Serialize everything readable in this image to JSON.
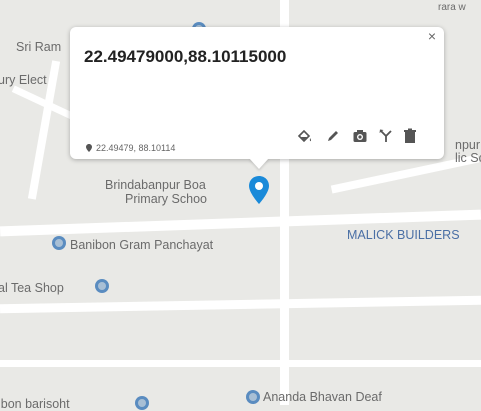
{
  "map": {
    "labels": {
      "sri_ram": "Sri Ram",
      "ury_elect": "ury Elect",
      "top_right": "rara w",
      "right_edge_1": "npur",
      "right_edge_2": "lic Sc",
      "school_1": "Brindabanpur Boa",
      "school_2": "Primary Schoo",
      "panchayat": "Banibon Gram Panchayat",
      "malick": "MALICK BUILDERS",
      "tea_shop": "al Tea Shop",
      "ananda": "Ananda Bhavan Deaf",
      "bottom_left": "ibon barisoht"
    },
    "colors": {
      "land": "#e9e9e6",
      "road": "#ffffff",
      "poi": "#5a8cc0",
      "marker": "#1a8ad9"
    }
  },
  "popup": {
    "title": "22.49479000,88.10115000",
    "close": "×",
    "coords": "22.49479, 88.10114",
    "tools": [
      "paint-bucket-icon",
      "pencil-icon",
      "camera-icon",
      "route-icon",
      "trash-icon"
    ]
  }
}
